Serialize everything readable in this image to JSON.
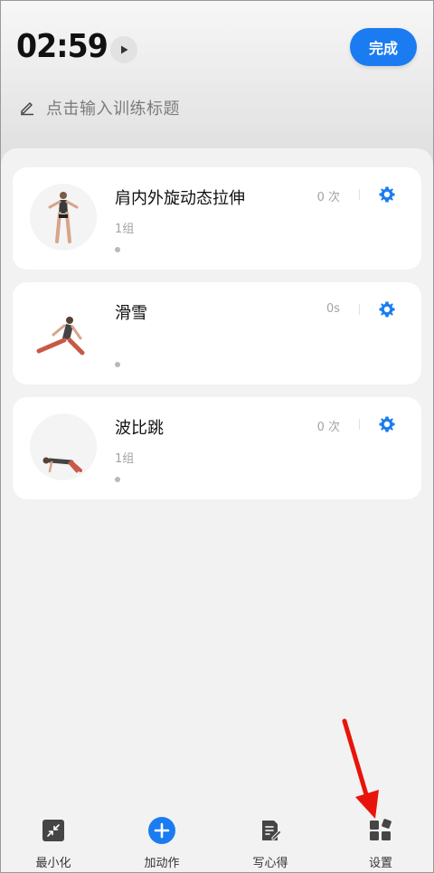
{
  "header": {
    "timer": "02:59",
    "done_label": "完成",
    "title_placeholder": "点击输入训练标题"
  },
  "exercises": [
    {
      "name": "肩内外旋动态拉伸",
      "sets": "1组",
      "count": "0 次",
      "icon": "gear-icon"
    },
    {
      "name": "滑雪",
      "sets": "",
      "count": "0s",
      "icon": "gear-icon"
    },
    {
      "name": "波比跳",
      "sets": "1组",
      "count": "0 次",
      "icon": "gear-icon"
    }
  ],
  "bottom_nav": [
    {
      "label": "最小化",
      "icon": "minimize-icon"
    },
    {
      "label": "加动作",
      "icon": "add-circle-icon"
    },
    {
      "label": "写心得",
      "icon": "note-edit-icon"
    },
    {
      "label": "设置",
      "icon": "grid-settings-icon"
    }
  ],
  "colors": {
    "accent": "#1a7cf0",
    "annotation_arrow": "#e8140c"
  }
}
